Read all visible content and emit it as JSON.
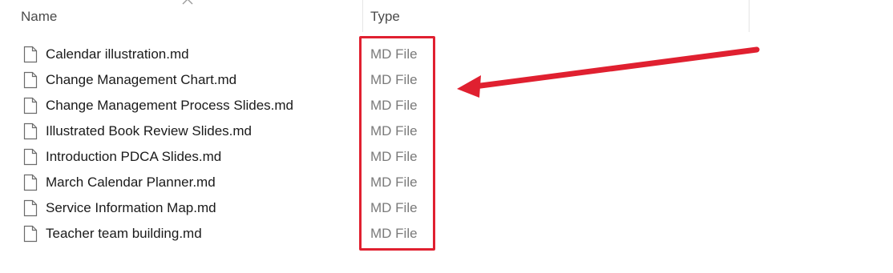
{
  "header": {
    "name_label": "Name",
    "type_label": "Type"
  },
  "files": [
    {
      "name": "Calendar illustration.md",
      "type": "MD File"
    },
    {
      "name": "Change Management Chart.md",
      "type": "MD File"
    },
    {
      "name": "Change Management Process Slides.md",
      "type": "MD File"
    },
    {
      "name": "Illustrated Book Review Slides.md",
      "type": "MD File"
    },
    {
      "name": "Introduction PDCA Slides.md",
      "type": "MD File"
    },
    {
      "name": "March Calendar Planner.md",
      "type": "MD File"
    },
    {
      "name": "Service Information Map.md",
      "type": "MD File"
    },
    {
      "name": "Teacher team building.md",
      "type": "MD File"
    }
  ],
  "icons": {
    "sort": "chevron-up-icon",
    "file": "document-icon"
  },
  "colors": {
    "annotation": "#e02030"
  }
}
